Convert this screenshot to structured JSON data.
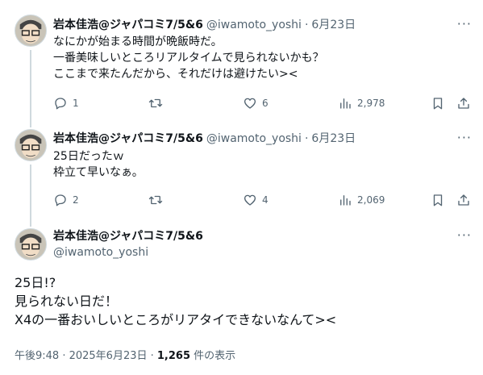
{
  "tweets": [
    {
      "name": "岩本佳浩@ジャパコミ7/5&6",
      "handle": "@iwamoto_yoshi",
      "dot": "·",
      "date": "6月23日",
      "lines": [
        "なにかが始まる時間が晩飯時だ。",
        "一番美味しいところリアルタイムで見られないかも？",
        "ここまで来たんだから、それだけは避けたい><"
      ],
      "replies": "1",
      "retweets": "",
      "likes": "6",
      "views": "2,978"
    },
    {
      "name": "岩本佳浩@ジャパコミ7/5&6",
      "handle": "@iwamoto_yoshi",
      "dot": "·",
      "date": "6月23日",
      "lines": [
        "25日だったｗ",
        "枠立て早いなぁ。"
      ],
      "replies": "2",
      "retweets": "",
      "likes": "4",
      "views": "2,069"
    }
  ],
  "main": {
    "name": "岩本佳浩@ジャパコミ7/5&6",
    "handle": "@iwamoto_yoshi",
    "lines": [
      "25日!?",
      "見られない日だ！",
      "X4の一番おいしいところがリアタイできないなんて><"
    ],
    "time": "午後9:48 · 2025年6月23日 · ",
    "views_count": "1,265",
    "views_label": " 件の表示"
  },
  "more_label": "···",
  "icons": [
    "reply-icon",
    "retweet-icon",
    "like-icon",
    "views-icon",
    "bookmark-icon",
    "share-icon",
    "more-icon"
  ],
  "colors": {
    "text": "#0f1419",
    "secondary": "#536471",
    "line": "#cfd9de"
  }
}
